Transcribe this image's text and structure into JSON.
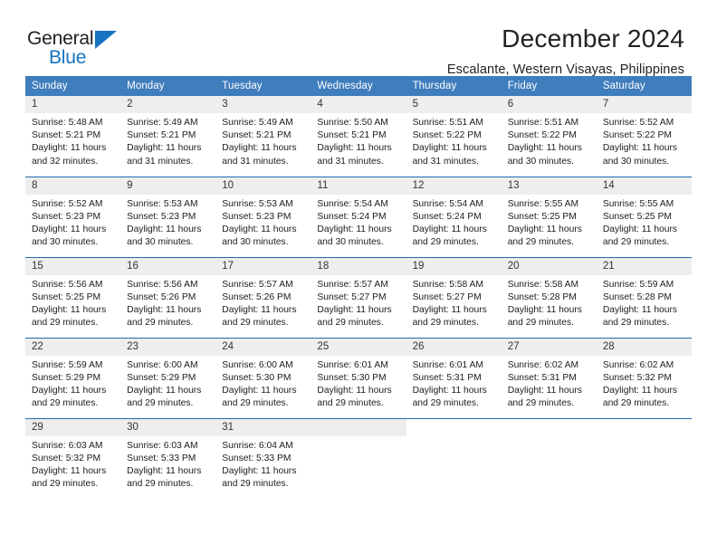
{
  "brand": {
    "name_top": "General",
    "name_bottom": "Blue",
    "triangle_color": "#1673c0"
  },
  "header": {
    "title": "December 2024",
    "subtitle": "Escalante, Western Visayas, Philippines"
  },
  "colors": {
    "header_blue": "#3f7dbd",
    "row_divider": "#1f6cad",
    "daynum_bg": "#eeeeee",
    "brand_blue": "#1673c0"
  },
  "weekday_headers": [
    "Sunday",
    "Monday",
    "Tuesday",
    "Wednesday",
    "Thursday",
    "Friday",
    "Saturday"
  ],
  "labels": {
    "sunrise_prefix": "Sunrise:",
    "sunset_prefix": "Sunset:",
    "daylight_prefix": "Daylight:"
  },
  "weeks": [
    [
      {
        "day": "1",
        "sunrise": "Sunrise: 5:48 AM",
        "sunset": "Sunset: 5:21 PM",
        "daylight": "Daylight: 11 hours and 32 minutes."
      },
      {
        "day": "2",
        "sunrise": "Sunrise: 5:49 AM",
        "sunset": "Sunset: 5:21 PM",
        "daylight": "Daylight: 11 hours and 31 minutes."
      },
      {
        "day": "3",
        "sunrise": "Sunrise: 5:49 AM",
        "sunset": "Sunset: 5:21 PM",
        "daylight": "Daylight: 11 hours and 31 minutes."
      },
      {
        "day": "4",
        "sunrise": "Sunrise: 5:50 AM",
        "sunset": "Sunset: 5:21 PM",
        "daylight": "Daylight: 11 hours and 31 minutes."
      },
      {
        "day": "5",
        "sunrise": "Sunrise: 5:51 AM",
        "sunset": "Sunset: 5:22 PM",
        "daylight": "Daylight: 11 hours and 31 minutes."
      },
      {
        "day": "6",
        "sunrise": "Sunrise: 5:51 AM",
        "sunset": "Sunset: 5:22 PM",
        "daylight": "Daylight: 11 hours and 30 minutes."
      },
      {
        "day": "7",
        "sunrise": "Sunrise: 5:52 AM",
        "sunset": "Sunset: 5:22 PM",
        "daylight": "Daylight: 11 hours and 30 minutes."
      }
    ],
    [
      {
        "day": "8",
        "sunrise": "Sunrise: 5:52 AM",
        "sunset": "Sunset: 5:23 PM",
        "daylight": "Daylight: 11 hours and 30 minutes."
      },
      {
        "day": "9",
        "sunrise": "Sunrise: 5:53 AM",
        "sunset": "Sunset: 5:23 PM",
        "daylight": "Daylight: 11 hours and 30 minutes."
      },
      {
        "day": "10",
        "sunrise": "Sunrise: 5:53 AM",
        "sunset": "Sunset: 5:23 PM",
        "daylight": "Daylight: 11 hours and 30 minutes."
      },
      {
        "day": "11",
        "sunrise": "Sunrise: 5:54 AM",
        "sunset": "Sunset: 5:24 PM",
        "daylight": "Daylight: 11 hours and 30 minutes."
      },
      {
        "day": "12",
        "sunrise": "Sunrise: 5:54 AM",
        "sunset": "Sunset: 5:24 PM",
        "daylight": "Daylight: 11 hours and 29 minutes."
      },
      {
        "day": "13",
        "sunrise": "Sunrise: 5:55 AM",
        "sunset": "Sunset: 5:25 PM",
        "daylight": "Daylight: 11 hours and 29 minutes."
      },
      {
        "day": "14",
        "sunrise": "Sunrise: 5:55 AM",
        "sunset": "Sunset: 5:25 PM",
        "daylight": "Daylight: 11 hours and 29 minutes."
      }
    ],
    [
      {
        "day": "15",
        "sunrise": "Sunrise: 5:56 AM",
        "sunset": "Sunset: 5:25 PM",
        "daylight": "Daylight: 11 hours and 29 minutes."
      },
      {
        "day": "16",
        "sunrise": "Sunrise: 5:56 AM",
        "sunset": "Sunset: 5:26 PM",
        "daylight": "Daylight: 11 hours and 29 minutes."
      },
      {
        "day": "17",
        "sunrise": "Sunrise: 5:57 AM",
        "sunset": "Sunset: 5:26 PM",
        "daylight": "Daylight: 11 hours and 29 minutes."
      },
      {
        "day": "18",
        "sunrise": "Sunrise: 5:57 AM",
        "sunset": "Sunset: 5:27 PM",
        "daylight": "Daylight: 11 hours and 29 minutes."
      },
      {
        "day": "19",
        "sunrise": "Sunrise: 5:58 AM",
        "sunset": "Sunset: 5:27 PM",
        "daylight": "Daylight: 11 hours and 29 minutes."
      },
      {
        "day": "20",
        "sunrise": "Sunrise: 5:58 AM",
        "sunset": "Sunset: 5:28 PM",
        "daylight": "Daylight: 11 hours and 29 minutes."
      },
      {
        "day": "21",
        "sunrise": "Sunrise: 5:59 AM",
        "sunset": "Sunset: 5:28 PM",
        "daylight": "Daylight: 11 hours and 29 minutes."
      }
    ],
    [
      {
        "day": "22",
        "sunrise": "Sunrise: 5:59 AM",
        "sunset": "Sunset: 5:29 PM",
        "daylight": "Daylight: 11 hours and 29 minutes."
      },
      {
        "day": "23",
        "sunrise": "Sunrise: 6:00 AM",
        "sunset": "Sunset: 5:29 PM",
        "daylight": "Daylight: 11 hours and 29 minutes."
      },
      {
        "day": "24",
        "sunrise": "Sunrise: 6:00 AM",
        "sunset": "Sunset: 5:30 PM",
        "daylight": "Daylight: 11 hours and 29 minutes."
      },
      {
        "day": "25",
        "sunrise": "Sunrise: 6:01 AM",
        "sunset": "Sunset: 5:30 PM",
        "daylight": "Daylight: 11 hours and 29 minutes."
      },
      {
        "day": "26",
        "sunrise": "Sunrise: 6:01 AM",
        "sunset": "Sunset: 5:31 PM",
        "daylight": "Daylight: 11 hours and 29 minutes."
      },
      {
        "day": "27",
        "sunrise": "Sunrise: 6:02 AM",
        "sunset": "Sunset: 5:31 PM",
        "daylight": "Daylight: 11 hours and 29 minutes."
      },
      {
        "day": "28",
        "sunrise": "Sunrise: 6:02 AM",
        "sunset": "Sunset: 5:32 PM",
        "daylight": "Daylight: 11 hours and 29 minutes."
      }
    ],
    [
      {
        "day": "29",
        "sunrise": "Sunrise: 6:03 AM",
        "sunset": "Sunset: 5:32 PM",
        "daylight": "Daylight: 11 hours and 29 minutes."
      },
      {
        "day": "30",
        "sunrise": "Sunrise: 6:03 AM",
        "sunset": "Sunset: 5:33 PM",
        "daylight": "Daylight: 11 hours and 29 minutes."
      },
      {
        "day": "31",
        "sunrise": "Sunrise: 6:04 AM",
        "sunset": "Sunset: 5:33 PM",
        "daylight": "Daylight: 11 hours and 29 minutes."
      },
      {
        "day": "",
        "sunrise": "",
        "sunset": "",
        "daylight": ""
      },
      {
        "day": "",
        "sunrise": "",
        "sunset": "",
        "daylight": ""
      },
      {
        "day": "",
        "sunrise": "",
        "sunset": "",
        "daylight": ""
      },
      {
        "day": "",
        "sunrise": "",
        "sunset": "",
        "daylight": ""
      }
    ]
  ]
}
